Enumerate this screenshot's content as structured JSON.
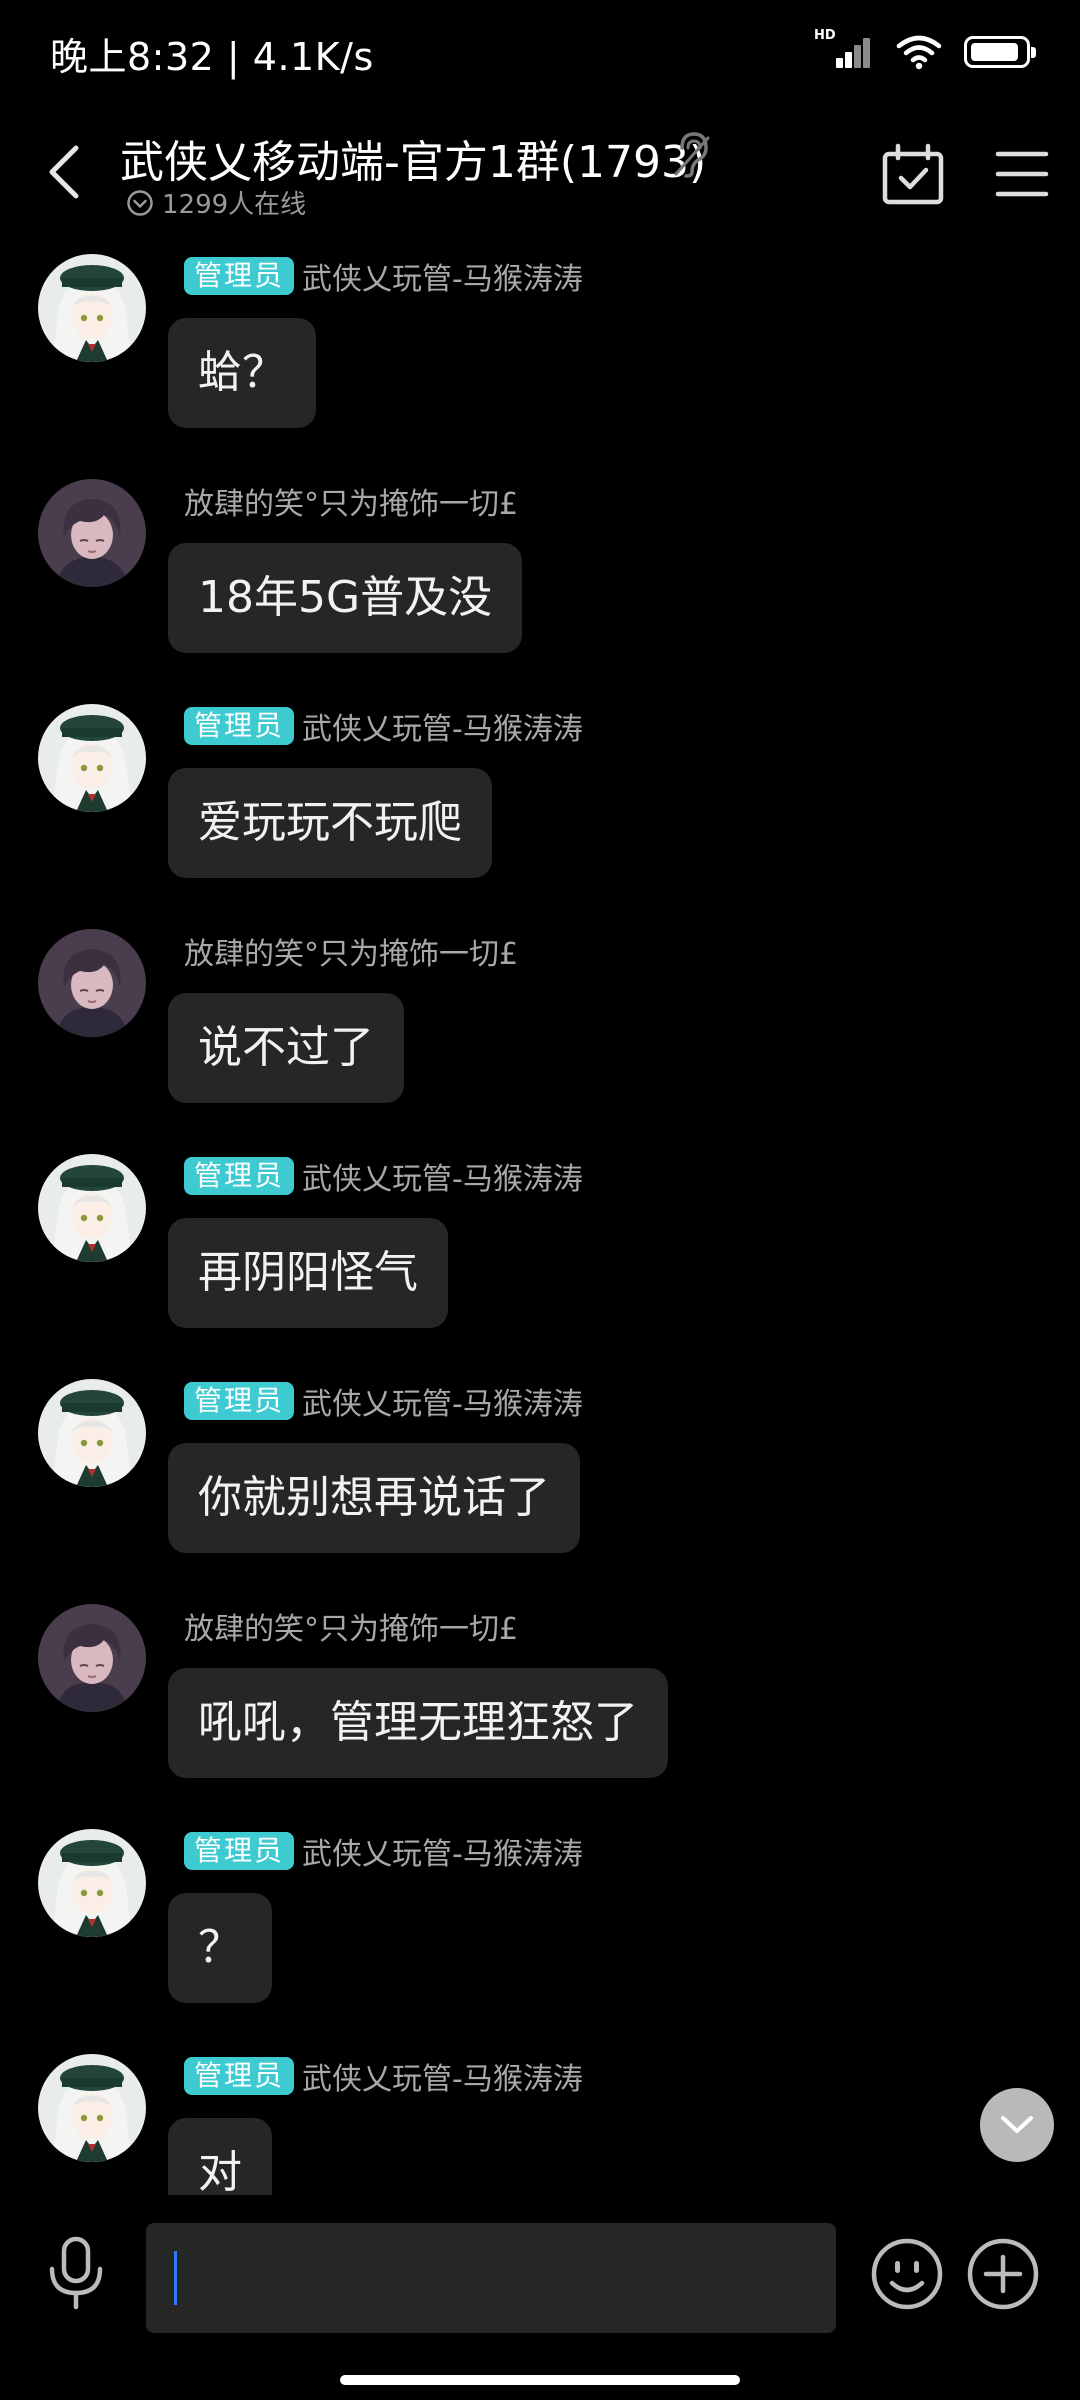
{
  "status_bar": {
    "time_speed": "晚上8:32 | 4.1K/s",
    "hd_label": "HD",
    "battery_level": 0.9
  },
  "header": {
    "title": "武侠乂移动端-官方1群(1793)",
    "online": "1299人在线"
  },
  "badge_label": "管理员",
  "messages": [
    {
      "sender": "武侠乂玩管-马猴涛涛",
      "admin": true,
      "avatar": "white-hair-girl",
      "text": "蛤？"
    },
    {
      "sender": "放肆的笑°只为掩饰一切£",
      "admin": false,
      "avatar": "dark-hair-boy",
      "text": "18年5G普及没"
    },
    {
      "sender": "武侠乂玩管-马猴涛涛",
      "admin": true,
      "avatar": "white-hair-girl",
      "text": "爱玩玩不玩爬"
    },
    {
      "sender": "放肆的笑°只为掩饰一切£",
      "admin": false,
      "avatar": "dark-hair-boy",
      "text": "说不过了"
    },
    {
      "sender": "武侠乂玩管-马猴涛涛",
      "admin": true,
      "avatar": "white-hair-girl",
      "text": "再阴阳怪气"
    },
    {
      "sender": "武侠乂玩管-马猴涛涛",
      "admin": true,
      "avatar": "white-hair-girl",
      "text": "你就别想再说话了"
    },
    {
      "sender": "放肆的笑°只为掩饰一切£",
      "admin": false,
      "avatar": "dark-hair-boy",
      "text": "吼吼，管理无理狂怒了"
    },
    {
      "sender": "武侠乂玩管-马猴涛涛",
      "admin": true,
      "avatar": "white-hair-girl",
      "text": "？"
    },
    {
      "sender": "武侠乂玩管-马猴涛涛",
      "admin": true,
      "avatar": "white-hair-girl",
      "text": "对"
    }
  ],
  "input": {
    "value": "",
    "placeholder": ""
  },
  "colors": {
    "background": "#000000",
    "bubble": "#262626",
    "admin_badge": "#3ecad1",
    "sender_text": "#a8a8a8",
    "caret": "#2b7bff"
  },
  "icons": {
    "back": "chevron-left-icon",
    "ear": "ear-icon",
    "online": "chevron-circle-icon",
    "calendar": "calendar-check-icon",
    "menu": "hamburger-menu-icon",
    "mic": "microphone-icon",
    "emoji": "smiley-icon",
    "plus": "plus-circle-icon",
    "scroll_down": "chevron-down-icon"
  }
}
